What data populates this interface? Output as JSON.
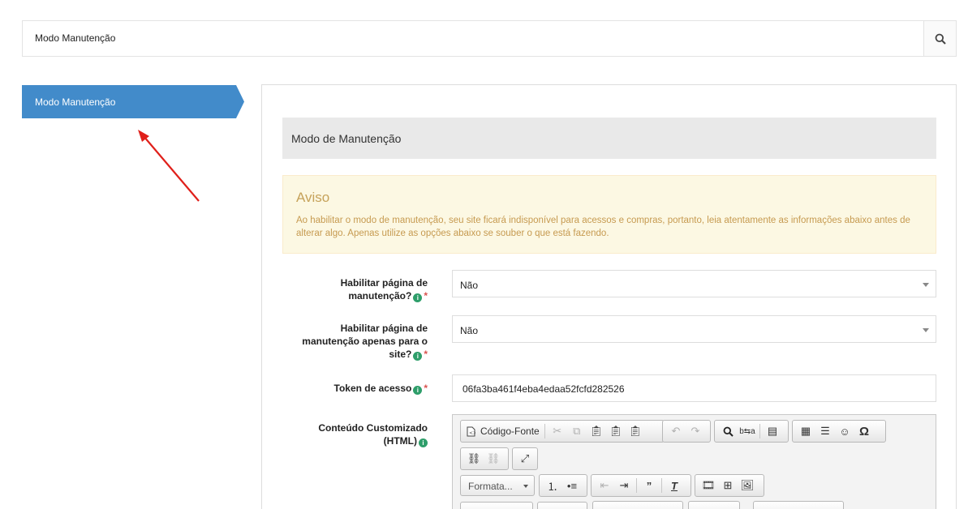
{
  "search": {
    "text": "Modo Manutenção",
    "icon": "search-icon"
  },
  "sidebar": {
    "active_item": "Modo Manutenção",
    "accent": "#428bca"
  },
  "section": {
    "title": "Modo de Manutenção"
  },
  "alert": {
    "title": "Aviso",
    "text": "Ao habilitar o modo de manutenção, seu site ficará indisponível para acessos e compras, portanto, leia atentamente as informações abaixo antes de alterar algo. Apenas utilize as opções abaixo se souber o que está fazendo."
  },
  "fields": {
    "maintenance": {
      "label_line1": "Habilitar página de",
      "label_line2": "manutenção?",
      "value": "Não"
    },
    "maintenance_site": {
      "label_line1": "Habilitar página de",
      "label_line2": "manutenção apenas para o",
      "label_line3": "site?",
      "value": "Não"
    },
    "token": {
      "label": "Token de acesso",
      "value": "06fa3ba461f4eba4edaa52fcfd282526"
    },
    "html": {
      "label_line1": "Conteúdo Customizado",
      "label_line2": "(HTML)"
    }
  },
  "editor": {
    "source_label": "Código-Fonte",
    "format_label": "Formata..."
  },
  "symbols": {
    "info": "i",
    "required": "*"
  }
}
